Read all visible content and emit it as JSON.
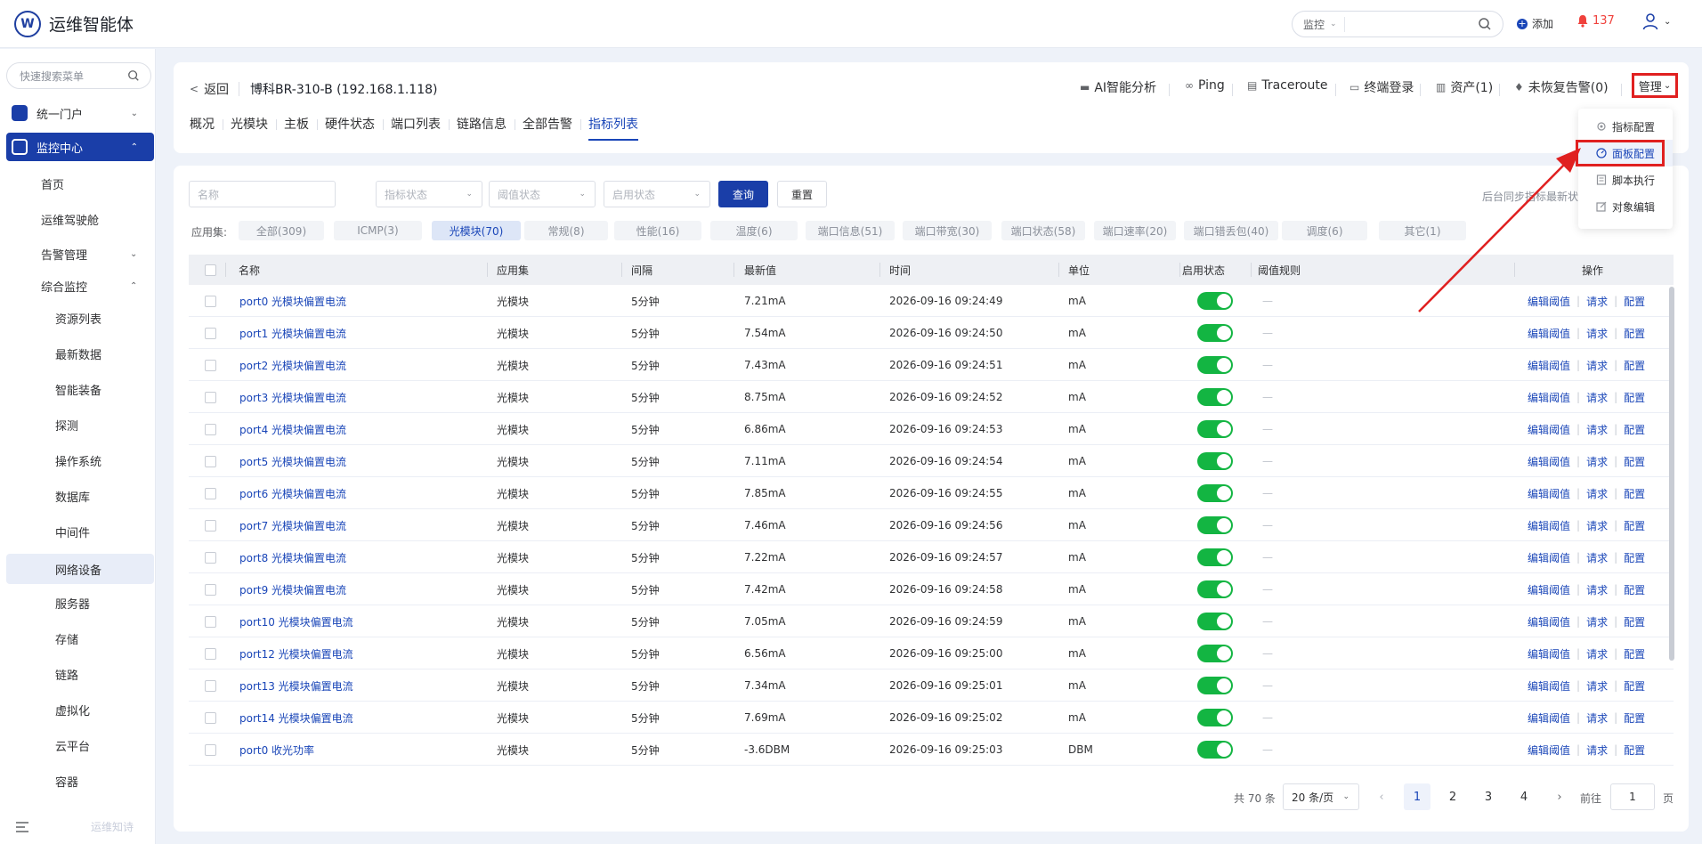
{
  "app": {
    "title": "运维智能体",
    "logo_letter": "W"
  },
  "topbar": {
    "search_scope": "监控",
    "search_placeholder": "",
    "add_label": "添加",
    "alert_count": "137"
  },
  "sidebar": {
    "search_placeholder": "快速搜索菜单",
    "groups": [
      {
        "label": "统一门户"
      },
      {
        "label": "监控中心"
      }
    ],
    "items": [
      {
        "label": "首页"
      },
      {
        "label": "运维驾驶舱"
      },
      {
        "label": "告警管理"
      },
      {
        "label": "综合监控"
      }
    ],
    "subitems": [
      {
        "label": "资源列表"
      },
      {
        "label": "最新数据"
      },
      {
        "label": "智能装备"
      },
      {
        "label": "探测"
      },
      {
        "label": "操作系统"
      },
      {
        "label": "数据库"
      },
      {
        "label": "中间件"
      },
      {
        "label": "网络设备"
      },
      {
        "label": "服务器"
      },
      {
        "label": "存储"
      },
      {
        "label": "链路"
      },
      {
        "label": "虚拟化"
      },
      {
        "label": "云平台"
      },
      {
        "label": "容器"
      }
    ],
    "bottom_text": "运维知诗"
  },
  "header": {
    "back_label": "返回",
    "device_name": "博科BR-310-B (192.168.1.118)",
    "actions": [
      {
        "label": "AI智能分析",
        "icon": "ai-icon"
      },
      {
        "label": "Ping",
        "icon": "link-icon"
      },
      {
        "label": "Traceroute",
        "icon": "route-icon"
      },
      {
        "label": "终端登录",
        "icon": "terminal-icon"
      },
      {
        "label": "资产(1)",
        "icon": "asset-icon"
      },
      {
        "label": "未恢复告警(0)",
        "icon": "bell-icon"
      }
    ],
    "manage_label": "管理",
    "tabs": [
      "概况",
      "光模块",
      "主板",
      "硬件状态",
      "端口列表",
      "链路信息",
      "全部告警",
      "指标列表"
    ],
    "active_tab": "指标列表"
  },
  "dropdown": {
    "items": [
      {
        "label": "指标配置",
        "icon": "gear-icon"
      },
      {
        "label": "面板配置",
        "icon": "dashboard-icon"
      },
      {
        "label": "脚本执行",
        "icon": "script-icon"
      },
      {
        "label": "对象编辑",
        "icon": "edit-icon"
      }
    ],
    "highlighted": "面板配置"
  },
  "filters": {
    "name_placeholder": "名称",
    "metric_status_placeholder": "指标状态",
    "threshold_status_placeholder": "阈值状态",
    "enable_status_placeholder": "启用状态",
    "query_label": "查询",
    "reset_label": "重置",
    "sync_text": "后台同步指标最新状"
  },
  "appsets": {
    "label": "应用集:",
    "chips": [
      "全部(309)",
      "ICMP(3)",
      "光模块(70)",
      "常规(8)",
      "性能(16)",
      "温度(6)",
      "端口信息(51)",
      "端口带宽(30)",
      "端口状态(58)",
      "端口速率(20)",
      "端口错丢包(40)",
      "调度(6)",
      "其它(1)"
    ],
    "active": "光模块(70)"
  },
  "table": {
    "columns": [
      "名称",
      "应用集",
      "间隔",
      "最新值",
      "时间",
      "单位",
      "启用状态",
      "阈值规则",
      "操作"
    ],
    "op_labels": [
      "编辑阈值",
      "请求",
      "配置"
    ],
    "rows": [
      {
        "name": "port0 光模块偏置电流",
        "appset": "光模块",
        "interval": "5分钟",
        "value": "7.21mA",
        "time": "2026-09-16 09:24:49",
        "unit": "mA",
        "enabled": true,
        "rule": "—"
      },
      {
        "name": "port1 光模块偏置电流",
        "appset": "光模块",
        "interval": "5分钟",
        "value": "7.54mA",
        "time": "2026-09-16 09:24:50",
        "unit": "mA",
        "enabled": true,
        "rule": "—"
      },
      {
        "name": "port2 光模块偏置电流",
        "appset": "光模块",
        "interval": "5分钟",
        "value": "7.43mA",
        "time": "2026-09-16 09:24:51",
        "unit": "mA",
        "enabled": true,
        "rule": "—"
      },
      {
        "name": "port3 光模块偏置电流",
        "appset": "光模块",
        "interval": "5分钟",
        "value": "8.75mA",
        "time": "2026-09-16 09:24:52",
        "unit": "mA",
        "enabled": true,
        "rule": "—"
      },
      {
        "name": "port4 光模块偏置电流",
        "appset": "光模块",
        "interval": "5分钟",
        "value": "6.86mA",
        "time": "2026-09-16 09:24:53",
        "unit": "mA",
        "enabled": true,
        "rule": "—"
      },
      {
        "name": "port5 光模块偏置电流",
        "appset": "光模块",
        "interval": "5分钟",
        "value": "7.11mA",
        "time": "2026-09-16 09:24:54",
        "unit": "mA",
        "enabled": true,
        "rule": "—"
      },
      {
        "name": "port6 光模块偏置电流",
        "appset": "光模块",
        "interval": "5分钟",
        "value": "7.85mA",
        "time": "2026-09-16 09:24:55",
        "unit": "mA",
        "enabled": true,
        "rule": "—"
      },
      {
        "name": "port7 光模块偏置电流",
        "appset": "光模块",
        "interval": "5分钟",
        "value": "7.46mA",
        "time": "2026-09-16 09:24:56",
        "unit": "mA",
        "enabled": true,
        "rule": "—"
      },
      {
        "name": "port8 光模块偏置电流",
        "appset": "光模块",
        "interval": "5分钟",
        "value": "7.22mA",
        "time": "2026-09-16 09:24:57",
        "unit": "mA",
        "enabled": true,
        "rule": "—"
      },
      {
        "name": "port9 光模块偏置电流",
        "appset": "光模块",
        "interval": "5分钟",
        "value": "7.42mA",
        "time": "2026-09-16 09:24:58",
        "unit": "mA",
        "enabled": true,
        "rule": "—"
      },
      {
        "name": "port10 光模块偏置电流",
        "appset": "光模块",
        "interval": "5分钟",
        "value": "7.05mA",
        "time": "2026-09-16 09:24:59",
        "unit": "mA",
        "enabled": true,
        "rule": "—"
      },
      {
        "name": "port12 光模块偏置电流",
        "appset": "光模块",
        "interval": "5分钟",
        "value": "6.56mA",
        "time": "2026-09-16 09:25:00",
        "unit": "mA",
        "enabled": true,
        "rule": "—"
      },
      {
        "name": "port13 光模块偏置电流",
        "appset": "光模块",
        "interval": "5分钟",
        "value": "7.34mA",
        "time": "2026-09-16 09:25:01",
        "unit": "mA",
        "enabled": true,
        "rule": "—"
      },
      {
        "name": "port14 光模块偏置电流",
        "appset": "光模块",
        "interval": "5分钟",
        "value": "7.69mA",
        "time": "2026-09-16 09:25:02",
        "unit": "mA",
        "enabled": true,
        "rule": "—"
      },
      {
        "name": "port0 收光功率",
        "appset": "光模块",
        "interval": "5分钟",
        "value": "-3.6DBM",
        "time": "2026-09-16 09:25:03",
        "unit": "DBM",
        "enabled": true,
        "rule": "—"
      }
    ]
  },
  "pagination": {
    "total_text": "共 70 条",
    "page_size": "20 条/页",
    "pages": [
      "1",
      "2",
      "3",
      "4"
    ],
    "current": "1",
    "goto_label": "前往",
    "goto_value": "1",
    "page_suffix": "页"
  },
  "colors": {
    "primary": "#1a46b8",
    "sidebar_active": "#1a3ea8",
    "switch_on": "#13b542",
    "alert": "#f0413c",
    "annotation": "#e02020"
  }
}
